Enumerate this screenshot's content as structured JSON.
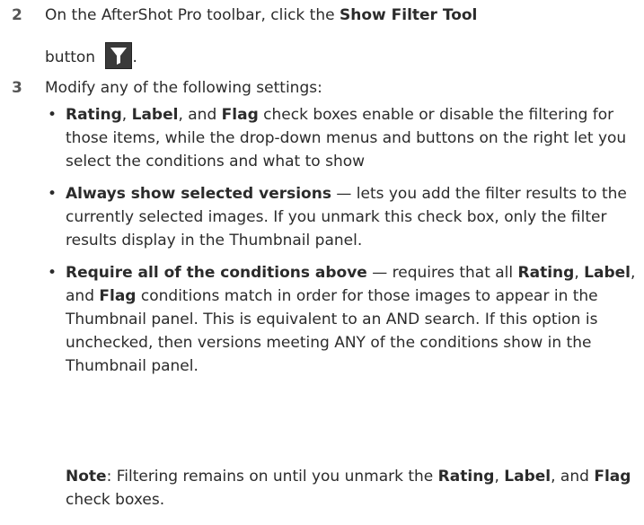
{
  "step2": {
    "number": "2",
    "prefix": "On the AfterShot Pro toolbar, click the ",
    "bold": "Show Filter Tool",
    "line2": "button ",
    "end": ".",
    "icon": "filter-funnel-icon"
  },
  "step3": {
    "number": "3",
    "text": "Modify any of the following settings:"
  },
  "bullets": [
    {
      "b1": "Rating",
      "t1": ", ",
      "b2": "Label",
      "t2": ", and ",
      "b3": "Flag",
      "t3": " check boxes enable or disable the filtering for those items, while the drop-down menus and buttons on the right let you select the conditions and what to show"
    },
    {
      "b1": "Always show selected versions",
      "t1": " — lets you add the filter results to the currently selected images. If you unmark this check box, only the filter results display in the Thumbnail panel."
    },
    {
      "b1": "Require all of the conditions above",
      "t1": " — requires that all ",
      "b2": "Rating",
      "t2": ", ",
      "b3": "Label",
      "t3": ", and ",
      "b4": "Flag",
      "t4": " conditions match in order for those images to appear in the Thumbnail panel. This is equivalent to an AND search. If this option is unchecked, then versions meeting ANY of the conditions show in the Thumbnail panel."
    }
  ],
  "note": {
    "label": "Note",
    "t1": ": Filtering remains on until you unmark the ",
    "b1": "Rating",
    "t2": ", ",
    "b2": "Label",
    "t3": ", and ",
    "b3": "Flag",
    "t4": " check boxes."
  },
  "colors": {
    "text": "#2b2b2b",
    "icon_bg": "#3a3a3a"
  }
}
